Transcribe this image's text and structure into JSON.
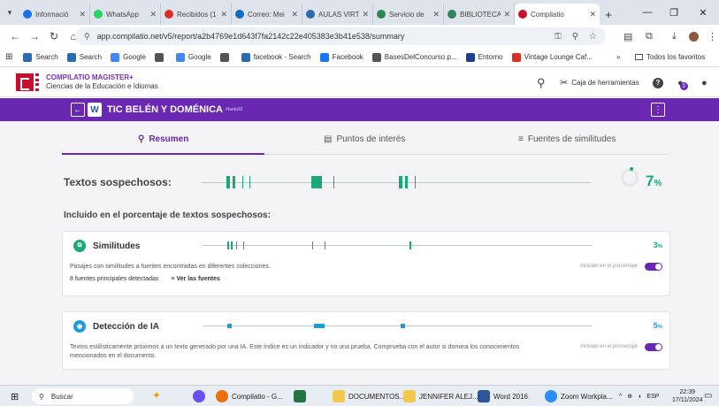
{
  "browser": {
    "tabs": [
      {
        "label": "Informació",
        "color": "#1a73e8"
      },
      {
        "label": "WhatsApp",
        "color": "#25d366"
      },
      {
        "label": "Recibidos (1",
        "color": "#d93025"
      },
      {
        "label": "Correo: Mei",
        "color": "#0f6cbd"
      },
      {
        "label": "AULAS VIRT",
        "color": "#2b6cb0"
      },
      {
        "label": "Servicio de",
        "color": "#2f855a"
      },
      {
        "label": "BIBLIOTECA",
        "color": "#2f855a"
      },
      {
        "label": "Compilatio",
        "color": "#c8102e"
      }
    ],
    "new_tab": "+",
    "address": "app.compilatio.net/v5/report/a2b4769e1d643f7fa2142c22e405383e3b41e538/summary",
    "bookmarks": [
      {
        "label": "Search",
        "color": "#2b6cb0"
      },
      {
        "label": "Search",
        "color": "#2b6cb0"
      },
      {
        "label": "Google",
        "color": "#4285f4"
      },
      {
        "label": "",
        "color": "#555555"
      },
      {
        "label": "Google",
        "color": "#4285f4"
      },
      {
        "label": "",
        "color": "#555555"
      },
      {
        "label": "facebook - Search",
        "color": "#2b6cb0"
      },
      {
        "label": "Facebook",
        "color": "#1877f2"
      },
      {
        "label": "BasesDelConcurso.p...",
        "color": "#555555"
      },
      {
        "label": "Entorno",
        "color": "#1c3f94"
      },
      {
        "label": "Vintage Lounge Caf...",
        "color": "#d93025"
      }
    ],
    "bookmarks_more": "»",
    "all_bookmarks": "Todos los favoritos"
  },
  "app": {
    "brand_line1": "COMPILATIO MAGISTER+",
    "brand_line2": "Ciencias de la Educación e Idiomas",
    "tools_label": "Caja de herramientas",
    "notif_count": "3"
  },
  "doc": {
    "title": "TIC BELÉN Y DOMÉNICA",
    "tag": "#bada92",
    "back": "←",
    "file_icon": "W",
    "menu": "⋮"
  },
  "report": {
    "tabs": [
      {
        "label": "Resumen",
        "icon": "search-icon"
      },
      {
        "label": "Puntos de interés",
        "icon": "list-icon"
      },
      {
        "label": "Fuentes de similitudes",
        "icon": "lines-icon"
      }
    ],
    "suspicious_label": "Textos sospechosos:",
    "suspicious_pct": "7",
    "suspicious_pct_unit": "%",
    "included_label": "Incluido en el porcentaje de textos sospechosos:",
    "cards": [
      {
        "title": "Similitudes",
        "pct": "3",
        "unit": "%",
        "accent": "#1aa876",
        "desc": "Pasajes con similitudes a fuentes encontradas en diferentes colecciones.",
        "included": "Incluido en el porcentaje",
        "sources_count": "8 fuentes principales detectadas",
        "view_sources": "Ver las fuentes"
      },
      {
        "title": "Detección de IA",
        "pct": "5",
        "unit": "%",
        "accent": "#1e9cd7",
        "desc": "Textos estilísticamente próximos a un texto generado por una IA. Este índice es un indicador y no una prueba. Comprueba con el autor si domina los conocimientos mencionados en el documento.",
        "included": "Incluido en el porcentaje"
      }
    ]
  },
  "taskbar": {
    "search_placeholder": "Buscar",
    "apps": [
      {
        "label": "Compilatio - G...",
        "color": "#e8710a"
      },
      {
        "label": "",
        "color": "#217346"
      },
      {
        "label": "DOCUMENTOS...",
        "color": "#f2c94c"
      },
      {
        "label": "JENNIFER ALEJ...",
        "color": "#f2c94c"
      },
      {
        "label": "Word 2016",
        "color": "#2b579a"
      },
      {
        "label": "Zoom Workpla...",
        "color": "#2d8cff"
      }
    ],
    "lang": "ESP",
    "time": "22:39",
    "date": "17/11/2024"
  }
}
